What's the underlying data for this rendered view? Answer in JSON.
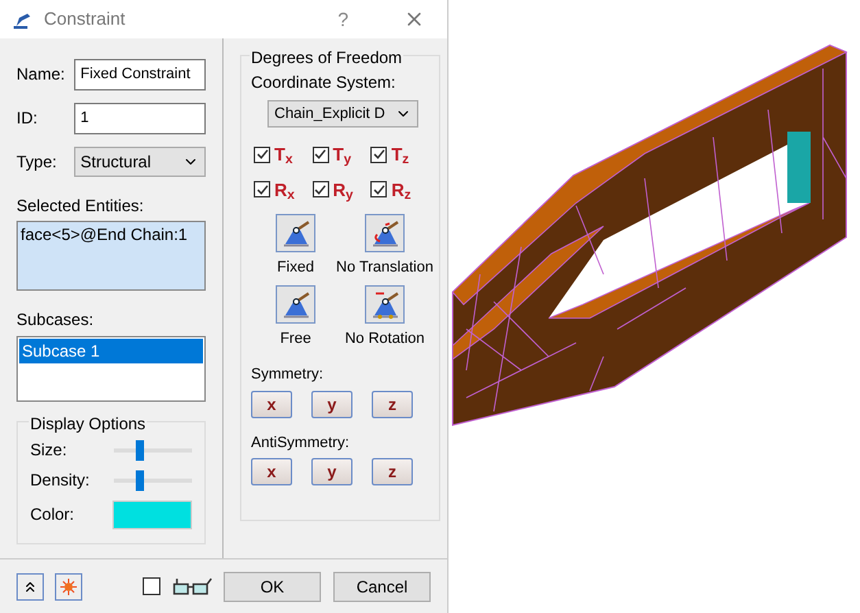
{
  "window": {
    "title": "Constraint",
    "help": "?"
  },
  "fields": [
    {
      "kind": "text",
      "label": "Name:",
      "value": "Fixed Constraint"
    },
    {
      "kind": "text",
      "label": "ID:",
      "value": "1"
    },
    {
      "kind": "dropdown",
      "label": "Type:",
      "value": "Structural"
    }
  ],
  "selected_entities": {
    "label": "Selected Entities:",
    "items": [
      "face<5>@End Chain:1"
    ]
  },
  "subcases": {
    "label": "Subcases:",
    "items": [
      {
        "label": "Subcase 1",
        "selected": true
      }
    ]
  },
  "display_options": {
    "title": "Display Options",
    "sliders": [
      {
        "label": "Size:",
        "level": 0.3
      },
      {
        "label": "Density:",
        "level": 0.3
      }
    ],
    "color": {
      "label": "Color:",
      "color": "#00e0e0"
    }
  },
  "degrees_of_freedom": {
    "title": "Degrees of Freedom",
    "coordinate_label": "Coordinate System:",
    "coordinate_value": "Chain_Explicit D",
    "checks": [
      {
        "label": "T$_{x}$",
        "checked": true
      },
      {
        "label": "T$_{y}$",
        "checked": true
      },
      {
        "label": "T$_{z}$",
        "checked": true
      },
      {
        "label": "R$_{x}$",
        "checked": true
      },
      {
        "label": "R$_{y}$",
        "checked": true
      },
      {
        "label": "R$_{z}$",
        "checked": true
      }
    ],
    "presets": [
      {
        "kind": "fixed",
        "label": "Fixed"
      },
      {
        "kind": "no_translation",
        "label": "No Translation"
      },
      {
        "kind": "free",
        "label": "Free"
      },
      {
        "kind": "no_rotation",
        "label": "No Rotation"
      }
    ],
    "symmetry": {
      "label": "Symmetry:",
      "buttons": [
        "x",
        "y",
        "z"
      ]
    },
    "antisymmetry": {
      "label": "AntiSymmetry:",
      "buttons": [
        "x",
        "y",
        "z"
      ]
    }
  },
  "footer": {
    "show_checked": false,
    "buttons": [
      "OK",
      "Cancel"
    ]
  }
}
